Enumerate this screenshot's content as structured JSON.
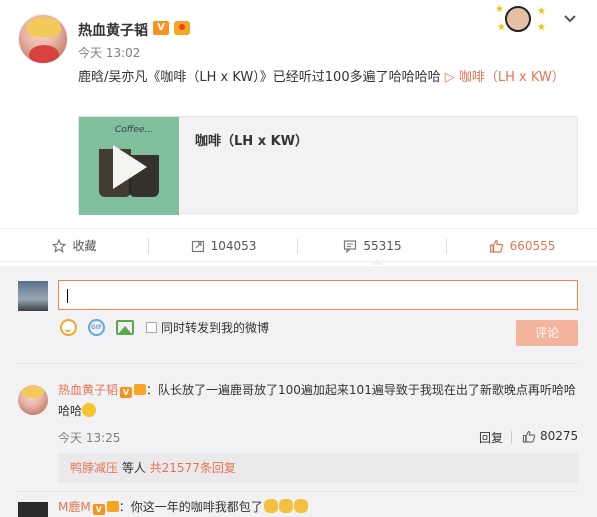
{
  "post": {
    "author": "热血黄子韬",
    "verified_badge": "V",
    "time": "今天 13:02",
    "text_before": "鹿晗/吴亦凡《咖啡（LH x KW）》已经听过100多遍了哈哈哈哈 ",
    "music_link": "▷ 咖啡（LH x KW）",
    "music_card": {
      "cover_text": "Coffee...",
      "title": "咖啡（LH x KW）"
    }
  },
  "actions": {
    "favorite_label": "收藏",
    "repost_count": "104053",
    "comment_count": "55315",
    "like_count": "660555"
  },
  "composer": {
    "repost_label": "同时转发到我的微博",
    "submit_label": "评论",
    "gif_label": "GIF"
  },
  "comments": [
    {
      "user": "热血黄子韬",
      "badge": "V",
      "text": "：队长放了一遍鹿哥放了100遍加起来101遍导致于我现在出了新歌晚点再听哈哈哈哈",
      "time": "今天 13:25",
      "reply_label": "回复",
      "likes": "80275",
      "summary": {
        "user": "鸭脖减压",
        "middle": " 等人 ",
        "count_link": "共21577条回复"
      }
    },
    {
      "user": "M鹿M",
      "badge": "V",
      "text": "：你这一年的咖啡我都包了"
    }
  ],
  "icons": {
    "star": "star-icon",
    "repost": "repost-icon",
    "comment": "comment-icon",
    "like": "thumbs-up-icon",
    "chevron": "chevron-down-icon",
    "smiley": "smiley-icon",
    "gif": "gif-icon",
    "image": "image-icon"
  },
  "colors": {
    "accent": "#eb7350",
    "input_border": "#ff8140",
    "submit_disabled": "#f4b39b",
    "verified": "#f7931e"
  }
}
